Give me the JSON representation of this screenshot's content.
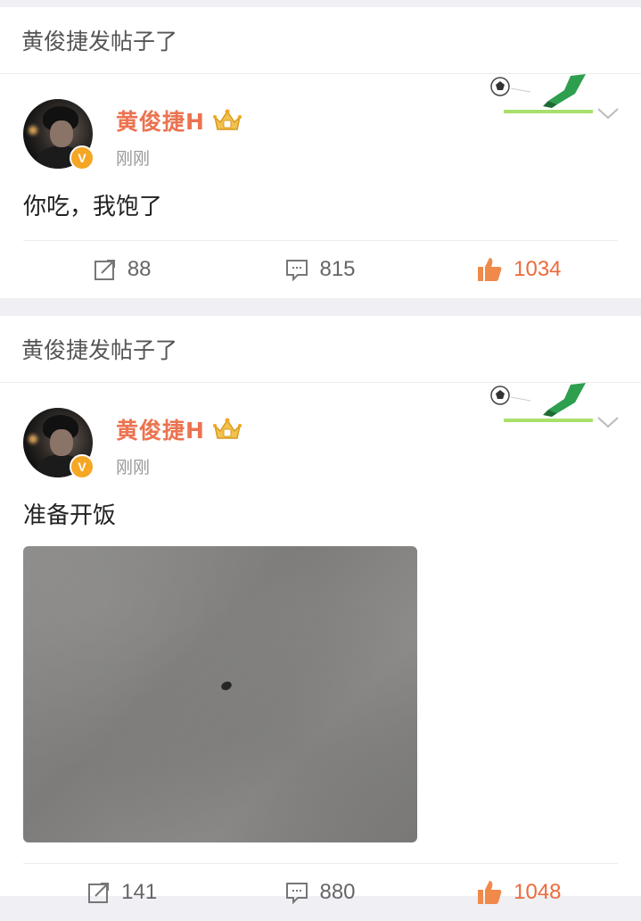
{
  "feed": [
    {
      "header": "黄俊捷发帖子了",
      "author": "黄俊捷H",
      "time": "刚刚",
      "verified_badge": "V",
      "text": "你吃，我饱了",
      "has_image": false,
      "stats": {
        "repost": "88",
        "comment": "815",
        "like": "1034"
      }
    },
    {
      "header": "黄俊捷发帖子了",
      "author": "黄俊捷H",
      "time": "刚刚",
      "verified_badge": "V",
      "text": "准备开饭",
      "has_image": true,
      "stats": {
        "repost": "141",
        "comment": "880",
        "like": "1048"
      }
    }
  ],
  "colors": {
    "name": "#eb7350",
    "like": "#eb6b3c",
    "badge": "#f5a623",
    "background": "#efeff4"
  },
  "icons": [
    "repost-icon",
    "comment-icon",
    "like-icon",
    "chevron-down-icon",
    "crown-icon",
    "soccer-decoration-icon",
    "verified-badge-icon"
  ]
}
